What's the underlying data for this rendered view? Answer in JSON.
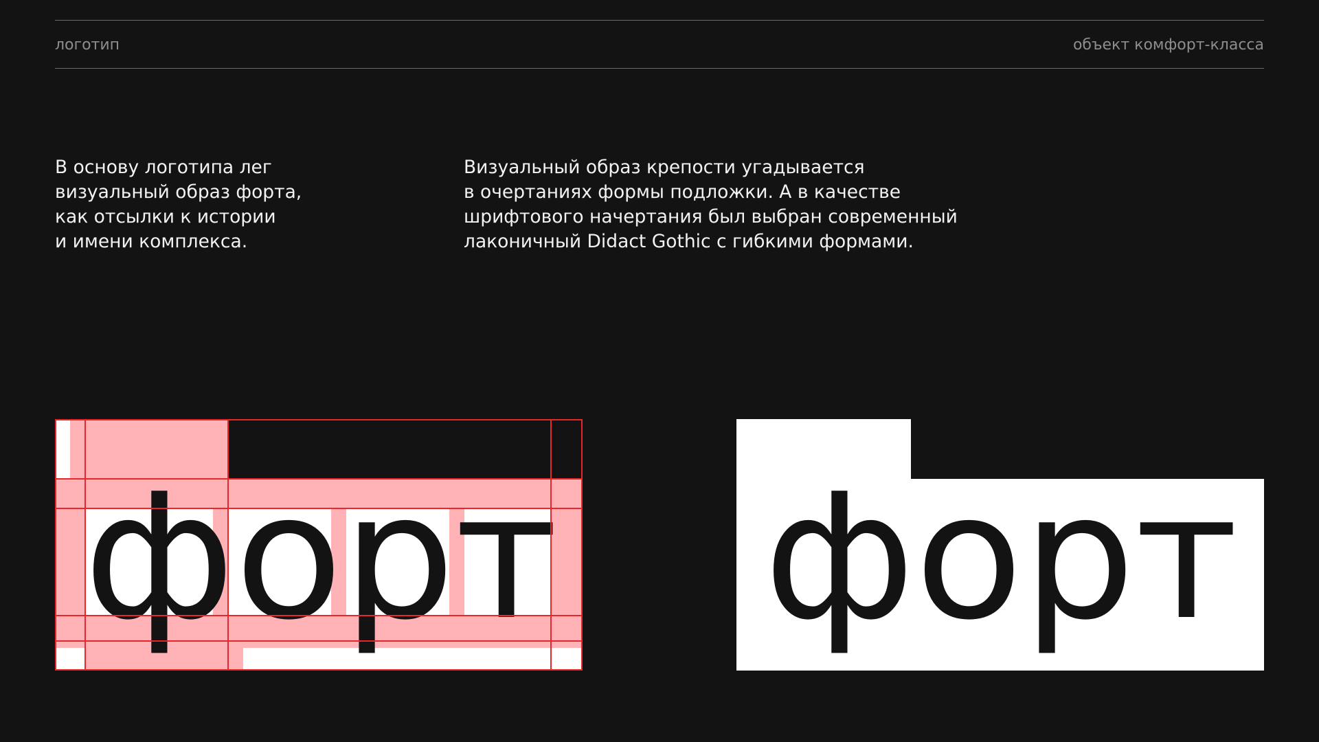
{
  "header": {
    "left_label": "логотип",
    "right_label": "объект комфорт-класса"
  },
  "intro": {
    "left_lines": [
      "В основу логотипа лег",
      "визуальный образ форта,",
      "как отсылки к истории",
      "и имени комплекса."
    ],
    "right_lines": [
      "Визуальный образ крепости угадывается",
      "в очертаниях формы подложки. А в качестве",
      "шрифтового начертания был выбран современный",
      "лаконичный Didact Gothic с гибкими формами."
    ]
  },
  "logo": {
    "wordmark": "форт",
    "colors": {
      "background": "#131313",
      "plate": "#ffffff",
      "ink": "#131313",
      "grid_line": "#e8272c",
      "grid_fill": "#ffb3b6",
      "text_primary": "#f2f2f2",
      "text_secondary": "#8d8d8d"
    }
  }
}
